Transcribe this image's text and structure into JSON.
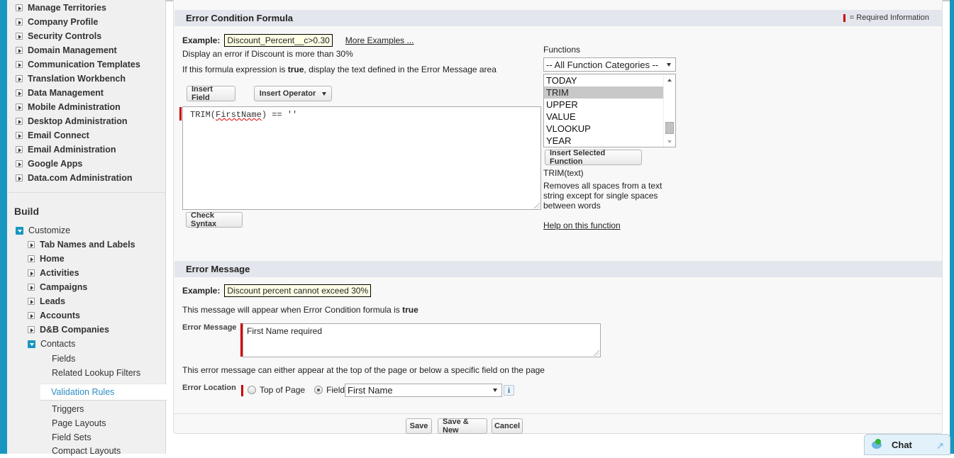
{
  "sidebar": {
    "admin_items": [
      {
        "label": "Manage Territories"
      },
      {
        "label": "Company Profile"
      },
      {
        "label": "Security Controls"
      },
      {
        "label": "Domain Management"
      },
      {
        "label": "Communication Templates"
      },
      {
        "label": "Translation Workbench"
      },
      {
        "label": "Data Management"
      },
      {
        "label": "Mobile Administration"
      },
      {
        "label": "Desktop Administration"
      },
      {
        "label": "Email Connect"
      },
      {
        "label": "Email Administration"
      },
      {
        "label": "Google Apps"
      },
      {
        "label": "Data.com Administration"
      }
    ],
    "build_heading": "Build",
    "customize_label": "Customize",
    "customize_items": [
      {
        "label": "Tab Names and Labels"
      },
      {
        "label": "Home"
      },
      {
        "label": "Activities"
      },
      {
        "label": "Campaigns"
      },
      {
        "label": "Leads"
      },
      {
        "label": "Accounts"
      },
      {
        "label": "D&B Companies"
      }
    ],
    "contacts_label": "Contacts",
    "contacts_items": [
      {
        "label": "Fields"
      },
      {
        "label": "Related Lookup Filters"
      },
      {
        "label": "Validation Rules",
        "selected": true
      },
      {
        "label": "Triggers"
      },
      {
        "label": "Page Layouts"
      },
      {
        "label": "Field Sets"
      },
      {
        "label": "Compact Layouts"
      }
    ]
  },
  "formula_section": {
    "title": "Error Condition Formula",
    "required_info": "= Required Information",
    "example_label": "Example:",
    "example_value": "Discount_Percent__c>0.30",
    "more_examples": "More Examples ...",
    "example_desc": "Display an error if Discount is more than 30%",
    "hint_prefix": "If this formula expression is ",
    "hint_bold": "true",
    "hint_suffix": ", display the text defined in the Error Message area",
    "insert_field": "Insert Field",
    "insert_operator": "Insert Operator",
    "formula_pre": "TRIM(",
    "formula_field": "FirstName",
    "formula_post": ") == ''",
    "check_syntax": "Check Syntax",
    "functions_label": "Functions",
    "function_category": "-- All Function Categories --",
    "function_list": [
      "TODAY",
      "TRIM",
      "UPPER",
      "VALUE",
      "VLOOKUP",
      "YEAR"
    ],
    "selected_function": "TRIM",
    "insert_selected_function": "Insert Selected Function",
    "function_signature": "TRIM(text)",
    "function_description": "Removes all spaces from a text string except for single spaces between words",
    "help_link": "Help on this function"
  },
  "message_section": {
    "title": "Error Message",
    "example_label": "Example:",
    "example_value": "Discount percent cannot exceed 30%",
    "hint_prefix": "This message will appear when Error Condition formula is ",
    "hint_bold": "true",
    "error_message_label": "Error Message",
    "error_message_value": "First Name required",
    "location_hint": "This error message can either appear at the top of the page or below a specific field on the page",
    "error_location_label": "Error Location",
    "option_top": "Top of Page",
    "option_field": "Field",
    "selected_option": "Field",
    "field_value": "First Name"
  },
  "footer": {
    "save": "Save",
    "save_new": "Save & New",
    "cancel": "Cancel"
  },
  "chat": {
    "label": "Chat"
  },
  "colors": {
    "accent": "#1797c0",
    "required": "#cc0000",
    "selected_link": "#2d8ec4"
  }
}
